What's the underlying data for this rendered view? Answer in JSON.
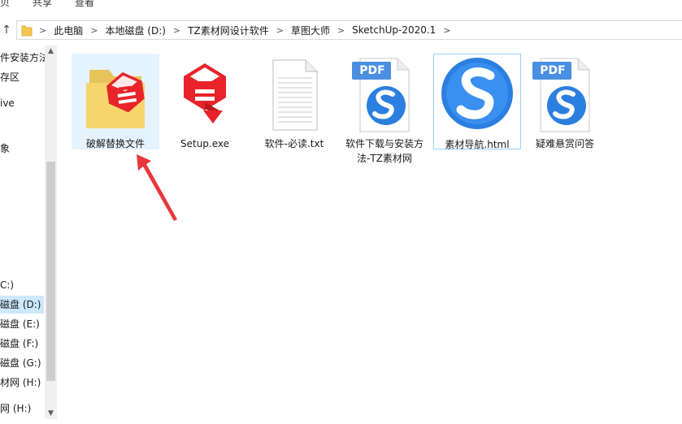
{
  "ribbon": {
    "tabs": [
      "贝",
      "共享",
      "查看"
    ]
  },
  "address": {
    "crumbs": [
      "此电脑",
      "本地磁盘 (D:)",
      "TZ素材网设计软件",
      "草图大师",
      "SketchUp-2020.1"
    ],
    "separator": ">"
  },
  "nav": {
    "items": [
      {
        "label": "件安装方法",
        "selected": false
      },
      {
        "label": "存区",
        "selected": false
      },
      {
        "label": "ive",
        "selected": false
      },
      {
        "label": "象",
        "selected": false
      },
      {
        "label": "C:)",
        "selected": false
      },
      {
        "label": "磁盘 (D:)",
        "selected": true
      },
      {
        "label": "磁盘 (E:)",
        "selected": false
      },
      {
        "label": "磁盘 (F:)",
        "selected": false
      },
      {
        "label": "磁盘 (G:)",
        "selected": false
      },
      {
        "label": "材网 (H:)",
        "selected": false
      },
      {
        "label": "网 (H:)",
        "selected": false
      }
    ]
  },
  "files": [
    {
      "name": "破解替换文件",
      "icon": "sketchup-folder-icon"
    },
    {
      "name": "Setup.exe",
      "icon": "sketchup-exe-icon"
    },
    {
      "name": "软件-必读.txt",
      "icon": "text-file-icon"
    },
    {
      "name": "软件下载与安装方法-TZ素材网",
      "icon": "pdf-file-icon"
    },
    {
      "name": "素材导航.html",
      "icon": "sogou-browser-icon"
    },
    {
      "name": "疑难悬赏问答",
      "icon": "pdf-file-icon"
    }
  ],
  "pdf_badge": "PDF",
  "colors": {
    "selection_bg": "#cce8ff",
    "sketchup_red": "#e8232a",
    "sogou_blue": "#2b7fe0",
    "annotation_arrow": "#e8373b"
  }
}
